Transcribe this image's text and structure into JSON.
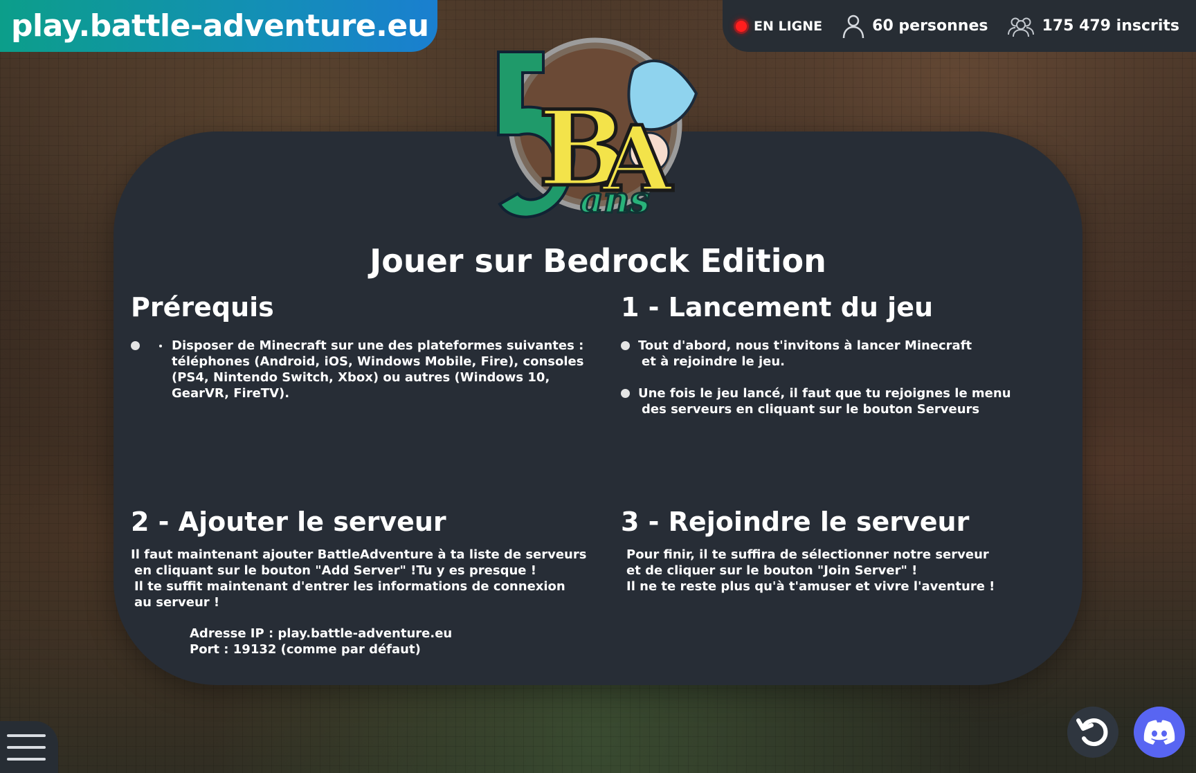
{
  "header": {
    "brand": "play.battle-adventure.eu",
    "status_online": "EN LIGNE",
    "players_online": "60 personnes",
    "registered": "175 479 inscrits"
  },
  "main": {
    "title": "Jouer sur Bedrock Edition",
    "prereq": {
      "heading": "Prérequis",
      "lines": [
        "Disposer de Minecraft sur une des plateformes suivantes :",
        "téléphones (Android, iOS, Windows Mobile, Fire), consoles",
        "(PS4, Nintendo Switch, Xbox) ou autres (Windows 10,",
        "GearVR, FireTV)."
      ]
    },
    "step1": {
      "heading": "1 - Lancement du jeu",
      "items": [
        {
          "line1": "Tout d'abord, nous t'invitons à lancer Minecraft",
          "line2": "et à rejoindre le jeu."
        },
        {
          "line1": "Une fois le jeu lancé, il faut que tu rejoignes le menu",
          "line2": "des serveurs en cliquant sur le bouton Serveurs"
        }
      ]
    },
    "step2": {
      "heading": "2 - Ajouter le serveur",
      "lines": [
        "Il faut maintenant ajouter BattleAdventure à ta liste de serveurs",
        "en cliquant sur le bouton \"Add Server\" !Tu y es presque !",
        "Il te suffit maintenant d'entrer les informations de connexion",
        "au serveur !"
      ],
      "ip": "Adresse IP : play.battle-adventure.eu",
      "port": "Port : 19132 (comme par défaut)"
    },
    "step3": {
      "heading": "3 - Rejoindre le serveur",
      "lines": [
        "Pour finir, il te suffira de sélectionner notre serveur",
        "et de cliquer sur le bouton \"Join Server\" !",
        "Il ne te reste plus qu'à t'amuser et vivre l'aventure !"
      ]
    }
  },
  "logo": {
    "letter_b": "B",
    "letter_a": "A",
    "number": "5",
    "word": "ans"
  },
  "icons": {
    "online": "red-dot-icon",
    "user": "user-icon",
    "users": "users-group-icon",
    "menu": "hamburger-menu-icon",
    "refresh": "refresh-icon",
    "discord": "discord-icon"
  },
  "colors": {
    "brand_gradient_start": "#0c9e8a",
    "brand_gradient_end": "#1a7fd0",
    "panel": "#272d36",
    "online_dot": "#ff1e1e",
    "discord": "#5865f2"
  }
}
